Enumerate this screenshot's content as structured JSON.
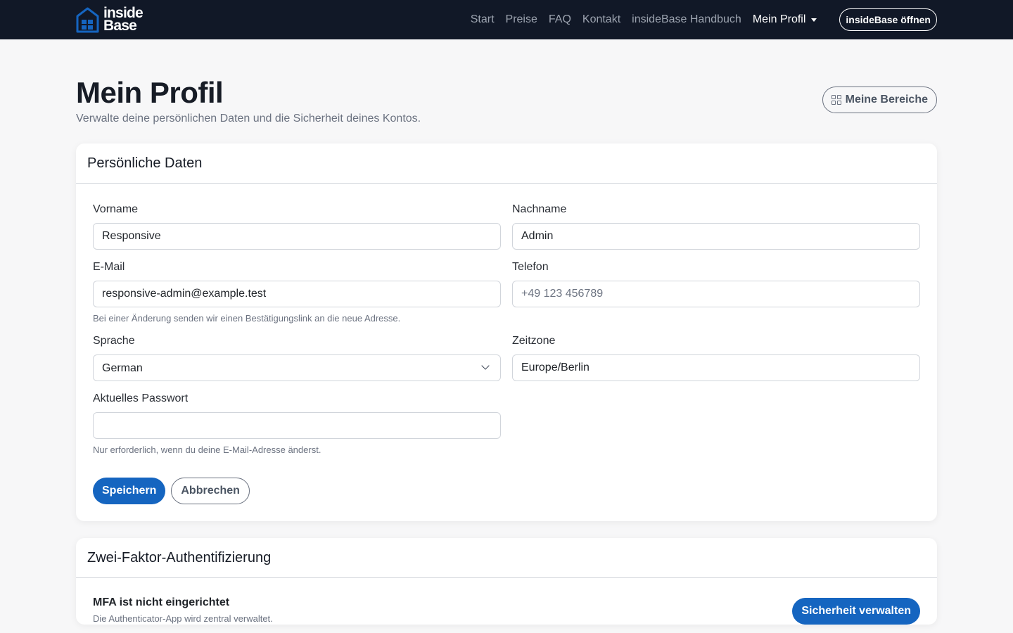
{
  "brand": {
    "line1": "inside",
    "line2": "Base",
    "accent": "#1565c0"
  },
  "nav": {
    "links": [
      "Start",
      "Preise",
      "FAQ",
      "Kontakt",
      "insideBase Handbuch"
    ],
    "profile": "Mein Profil",
    "open_button": "insideBase öffnen"
  },
  "header": {
    "title": "Mein Profil",
    "subtitle": "Verwalte deine persönlichen Daten und die Sicherheit deines Kontos.",
    "areas_button": "Meine Bereiche"
  },
  "personal": {
    "title": "Persönliche Daten",
    "first_name": {
      "label": "Vorname",
      "value": "Responsive"
    },
    "last_name": {
      "label": "Nachname",
      "value": "Admin"
    },
    "email": {
      "label": "E-Mail",
      "value": "responsive-admin@example.test",
      "help": "Bei einer Änderung senden wir einen Bestätigungslink an die neue Adresse."
    },
    "phone": {
      "label": "Telefon",
      "placeholder": "+49 123 456789"
    },
    "language": {
      "label": "Sprache",
      "value": "German"
    },
    "timezone": {
      "label": "Zeitzone",
      "value": "Europe/Berlin"
    },
    "password": {
      "label": "Aktuelles Passwort",
      "help": "Nur erforderlich, wenn du deine E-Mail-Adresse änderst."
    },
    "save_button": "Speichern",
    "cancel_button": "Abbrechen"
  },
  "mfa": {
    "title": "Zwei-Faktor-Authentifizierung",
    "status": "MFA ist nicht eingerichtet",
    "description": "Die Authenticator-App wird zentral verwaltet.",
    "manage_button": "Sicherheit verwalten"
  },
  "colors": {
    "navbar": "#111827",
    "primary": "#1565c0",
    "page_bg": "#f7f7f8"
  }
}
